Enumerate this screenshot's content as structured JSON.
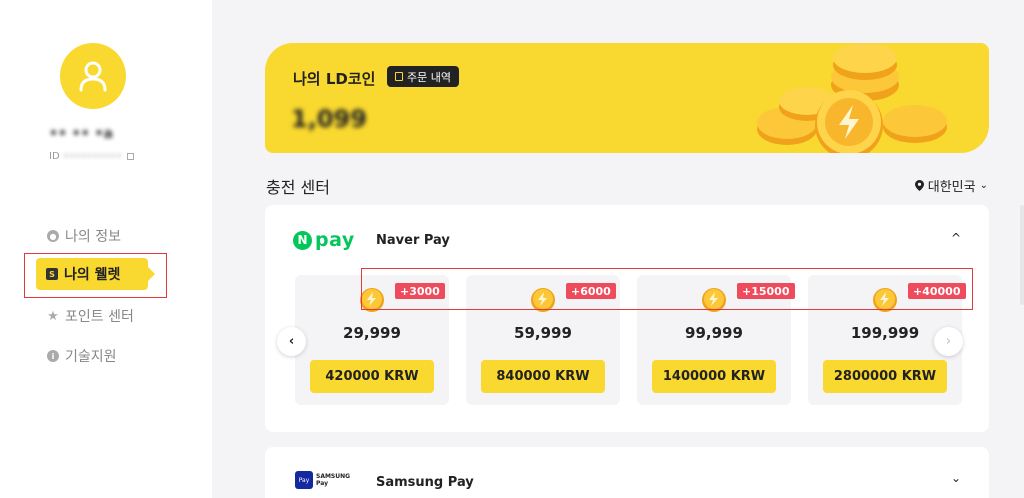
{
  "sidebar": {
    "user_name": "•• •• •a",
    "user_id_label": "ID",
    "user_id_value": "••••••••••",
    "items": [
      {
        "label": "나의 정보",
        "icon": "user-circle-icon"
      },
      {
        "label": "나의 웰렛",
        "icon": "wallet-icon"
      },
      {
        "label": "포인트 센터",
        "icon": "star-icon"
      },
      {
        "label": "기술지원",
        "icon": "info-icon"
      }
    ]
  },
  "banner": {
    "title": "나의 LD코인",
    "order_button": "주문 내역",
    "amount": "1,099"
  },
  "section": {
    "title": "충전 센터",
    "region": "대한민국"
  },
  "naver": {
    "logo_n": "N",
    "logo_pay": "pay",
    "name": "Naver Pay",
    "packages": [
      {
        "bonus": "+3000",
        "amount": "29,999",
        "price": "420000 KRW"
      },
      {
        "bonus": "+6000",
        "amount": "59,999",
        "price": "840000 KRW"
      },
      {
        "bonus": "+15000",
        "amount": "99,999",
        "price": "1400000 KRW"
      },
      {
        "bonus": "+40000",
        "amount": "199,999",
        "price": "2800000 KRW"
      }
    ]
  },
  "samsung": {
    "logo_line1": "SAMSUNG",
    "logo_line2": "Pay",
    "logo_square": "Pay",
    "name": "Samsung Pay"
  },
  "colors": {
    "accent": "#f9d92f",
    "bonus_badge": "#ee4b5d",
    "naver_green": "#03c75a",
    "highlight_box": "#e03a3a"
  }
}
